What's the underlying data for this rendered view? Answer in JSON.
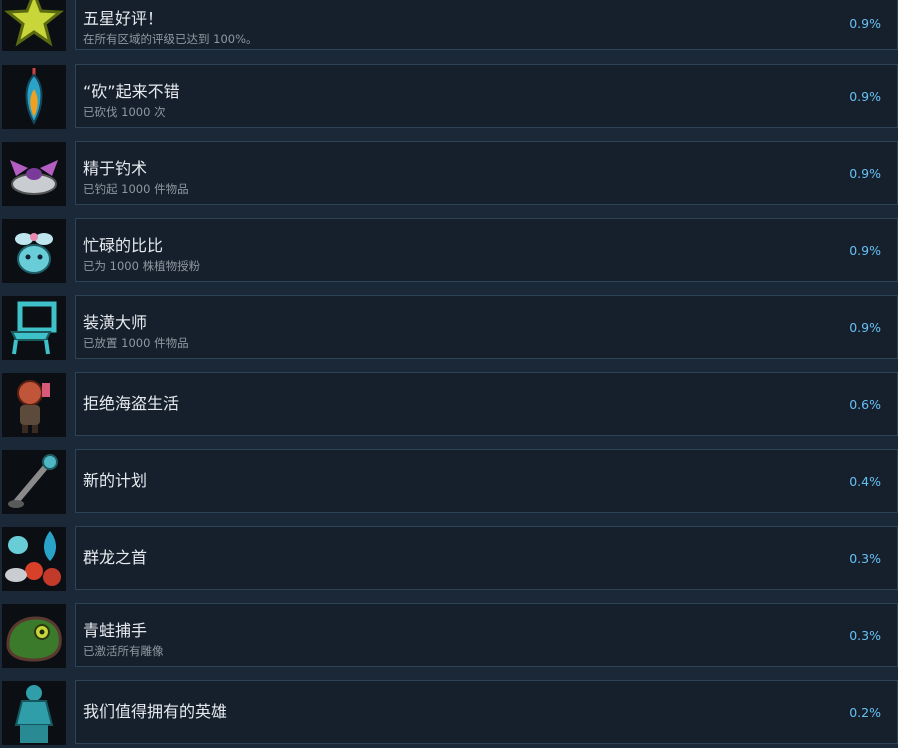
{
  "achievements": [
    {
      "icon": "star-icon",
      "title": "五星好评！",
      "desc": "在所有区域的评级已达到 100%。",
      "pct": "0.9%"
    },
    {
      "icon": "axe-feather-icon",
      "title": "“砍”起来不错",
      "desc": "已砍伐 1000 次",
      "pct": "0.9%"
    },
    {
      "icon": "fishing-bat-icon",
      "title": "精于钓术",
      "desc": "已钓起 1000 件物品",
      "pct": "0.9%"
    },
    {
      "icon": "bee-creature-icon",
      "title": "忙碌的比比",
      "desc": "已为 1000 株植物授粉",
      "pct": "0.9%"
    },
    {
      "icon": "chair-icon",
      "title": "装潢大师",
      "desc": "已放置 1000 件物品",
      "pct": "0.9%"
    },
    {
      "icon": "pirate-character-icon",
      "title": "拒绝海盗生活",
      "desc": "",
      "pct": "0.6%"
    },
    {
      "icon": "plunger-tool-icon",
      "title": "新的计划",
      "desc": "",
      "pct": "0.4%"
    },
    {
      "icon": "dragon-group-icon",
      "title": "群龙之首",
      "desc": "",
      "pct": "0.3%"
    },
    {
      "icon": "frog-icon",
      "title": "青蛙捕手",
      "desc": "已激活所有雕像",
      "pct": "0.3%"
    },
    {
      "icon": "hero-statue-icon",
      "title": "我们值得拥有的英雄",
      "desc": "",
      "pct": "0.2%"
    }
  ]
}
